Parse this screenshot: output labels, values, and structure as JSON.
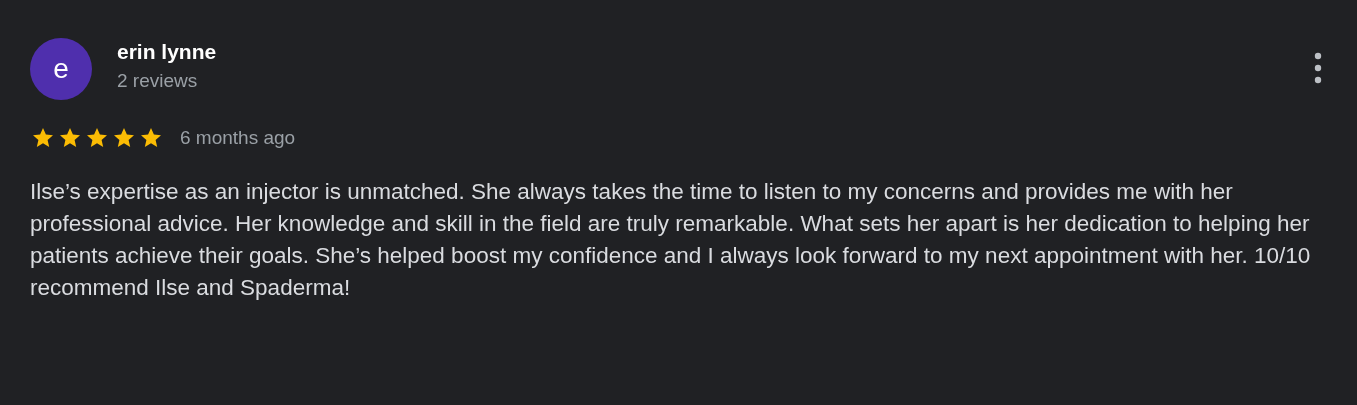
{
  "review": {
    "avatar_letter": "e",
    "name": "erin lynne",
    "reviews": "2 reviews",
    "stars": 5,
    "time": "6 months ago",
    "text": "Ilse’s expertise as an injector is unmatched. She always takes the time to listen to my concerns and provides me with her professional advice. Her knowledge and skill in the field are truly remarkable. What sets her apart is her dedication to helping her patients achieve their goals. She’s helped boost my confidence and I always look forward to my next appointment with her. 10/10 recommend Ilse and Spaderma!"
  }
}
